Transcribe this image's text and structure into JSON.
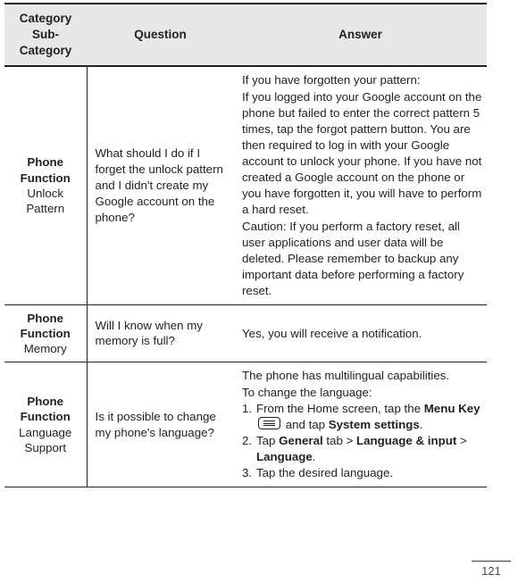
{
  "document": {
    "page_number": "121"
  },
  "table": {
    "headers": {
      "category": "Category\nSub-Category",
      "category_line1": "Category",
      "category_line2": "Sub-",
      "category_line3": "Category",
      "question": "Question",
      "answer": "Answer"
    },
    "rows": [
      {
        "category_main": "Phone Function",
        "category_sub_line1": "Unlock",
        "category_sub_line2": "Pattern",
        "question": "What should I do if I forget the unlock pattern and I didn't create my Google account on the phone?",
        "answer_paragraphs": [
          "If you have forgotten your pattern:",
          "If you logged into your Google account on the phone but failed to enter the correct pattern 5 times, tap the forgot pattern button. You are then required to log in with your Google account to unlock your phone. If you have not created a Google account on the phone or you have forgotten it, you will have to perform a hard reset.",
          "Caution: If you perform a factory reset, all user applications and user data will be deleted. Please remember to backup any important data before performing a factory reset."
        ]
      },
      {
        "category_main": "Phone Function",
        "category_sub_line1": "Memory",
        "category_sub_line2": "",
        "question": "Will I know when my memory is full?",
        "answer_paragraphs": [
          "Yes, you will receive a notification."
        ]
      },
      {
        "category_main": "Phone Function",
        "category_sub_line1": "Language",
        "category_sub_line2": "Support",
        "question": "Is it possible to change my phone's language?",
        "answer_intro_1": "The phone has multilingual capabilities.",
        "answer_intro_2": "To change the language:",
        "steps": [
          {
            "number": "1.",
            "text_1": "From the Home screen, tap the ",
            "bold_1": "Menu Key",
            "icon": "menu-key-icon",
            "text_2": " and tap ",
            "bold_2": "System settings",
            "text_3": "."
          },
          {
            "number": "2.",
            "text_1": "Tap ",
            "bold_1": "General",
            "text_2": " tab > ",
            "bold_2": "Language & input",
            "text_3": " > ",
            "bold_3": "Language",
            "text_4": "."
          },
          {
            "number": "3.",
            "text_1": "Tap the desired language.",
            "bold_1": "",
            "text_2": ""
          }
        ]
      }
    ]
  },
  "colors": {
    "header_background": "#e8e8e8",
    "text": "#231f20",
    "border": "#231f20",
    "page_number_text": "#4a4a4a"
  }
}
